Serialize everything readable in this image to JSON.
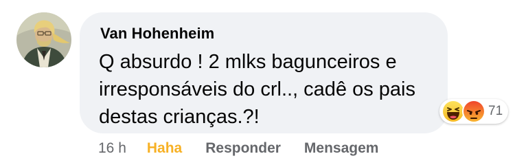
{
  "comment": {
    "author": "Van Hohenheim",
    "text": "Q absurdo ! 2 mlks bagunceiros e irresponsáveis do crl.., cadê os pais destas crianças.?!",
    "reactions": {
      "icons": [
        "haha-emoji-icon",
        "angry-emoji-icon"
      ],
      "count": "71"
    },
    "actions": {
      "time": "16 h",
      "haha_label": "Haha",
      "reply_label": "Responder",
      "message_label": "Mensagem"
    }
  },
  "colors": {
    "bubble": "#f0f2f5",
    "haha_active": "#f7b125",
    "meta_text": "#65676b"
  }
}
